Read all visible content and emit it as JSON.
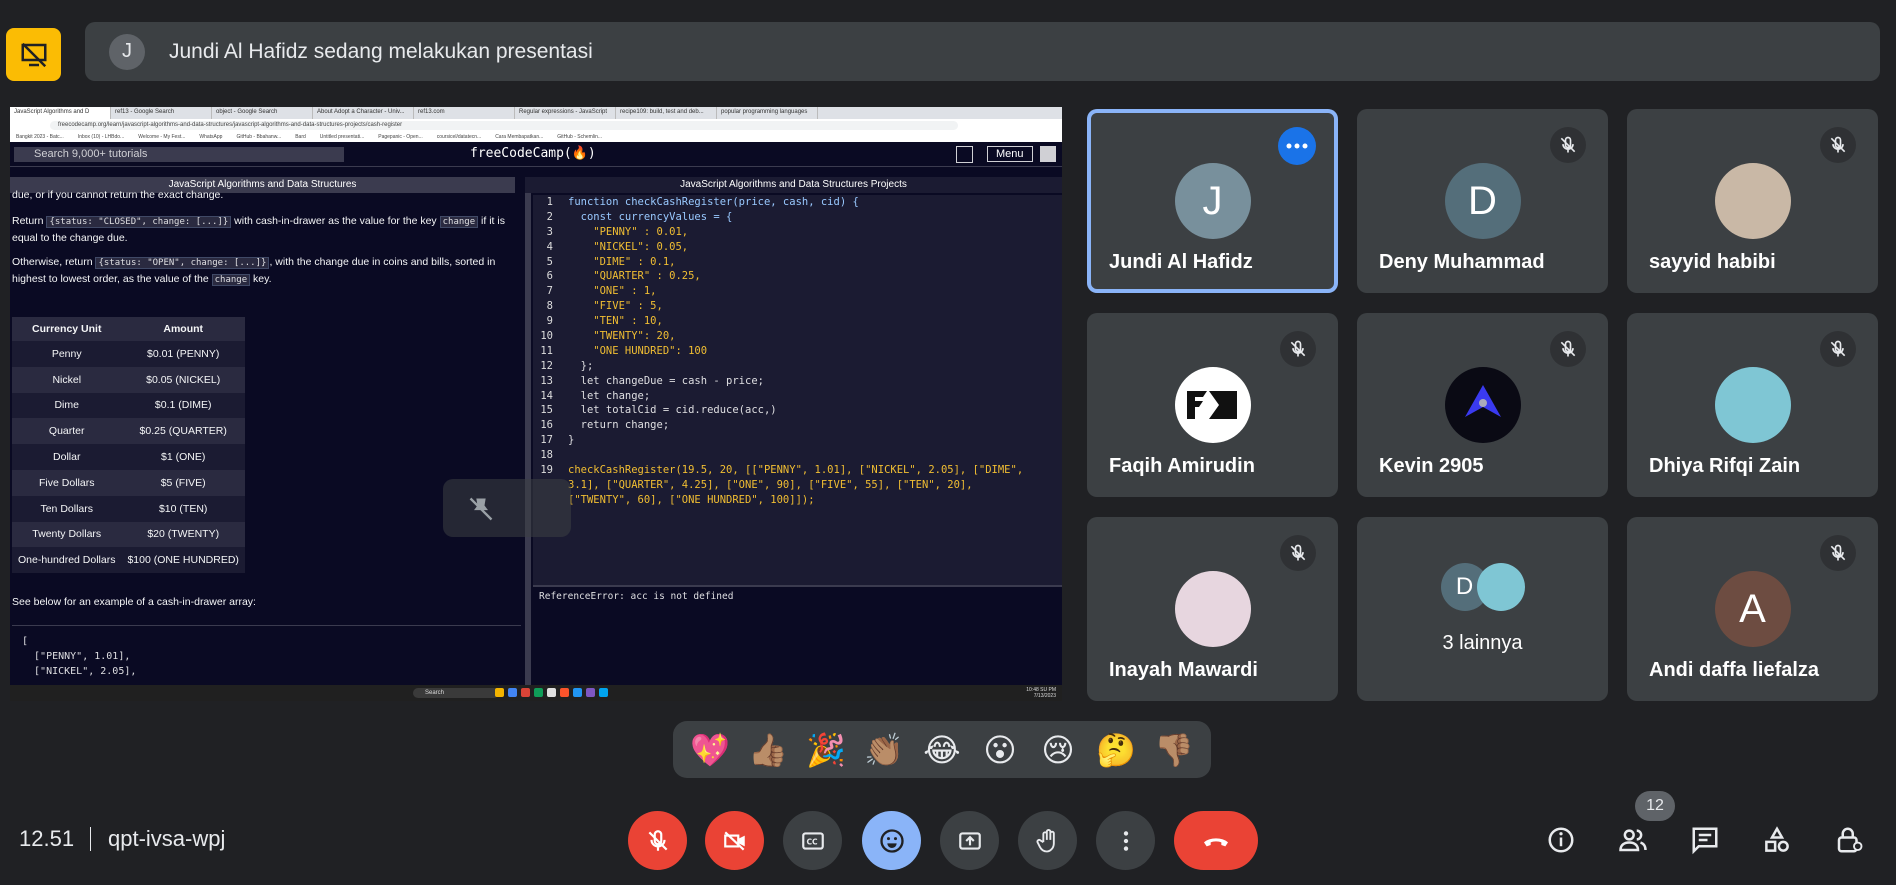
{
  "presentation": {
    "avatar_letter": "J",
    "banner_text": "Jundi Al Hafidz sedang melakukan presentasi"
  },
  "shared_screen": {
    "browser_tabs": [
      "JavaScript Algorithms and D",
      "ref13 - Google Search",
      "object - Google Search",
      "About Adopt a Character - Univ...",
      "ref13.com",
      "Regular expressions - JavaScript",
      "recipe109: build, test and deb...",
      "popular programming languages"
    ],
    "url": "freecodecamp.org/learn/javascript-algorithms-and-data-structures/javascript-algorithms-and-data-structures-projects/cash-register",
    "bookmarks": [
      "Bangkit 2023 - Batc...",
      "Inbox (10) - LHBdo...",
      "Welcome - My Fest...",
      "WhatsApp",
      "GitHub - Bbahanw...",
      "Bard",
      "Untitled presentati...",
      "Pagepanic - Open...",
      "coursicel/datatecn...",
      "Cara Membapatkan...",
      "GitHub - Schemlin..."
    ],
    "search_placeholder": "Search 9,000+ tutorials",
    "logo": "freeCodeCamp(🔥)",
    "menu_label": "Menu",
    "crumb_left": "JavaScript Algorithms and Data Structures",
    "crumb_right": "JavaScript Algorithms and Data Structures Projects",
    "desc_top": "due, or if you cannot return the exact change.",
    "desc_p1_a": "Return ",
    "desc_p1_code": "{status: \"CLOSED\", change: [...]}",
    "desc_p1_b": " with cash-in-drawer as the value for the key ",
    "desc_p1_code2": "change",
    "desc_p1_c": " if it is equal to the change due.",
    "desc_p2_a": "Otherwise, return ",
    "desc_p2_code": "{status: \"OPEN\", change: [...]}",
    "desc_p2_b": ", with the change due in coins and bills, sorted in highest to lowest order, as the value of the ",
    "desc_p2_code2": "change",
    "desc_p2_c": " key.",
    "table_headers": [
      "Currency Unit",
      "Amount"
    ],
    "table_rows": [
      [
        "Penny",
        "$0.01 (PENNY)"
      ],
      [
        "Nickel",
        "$0.05 (NICKEL)"
      ],
      [
        "Dime",
        "$0.1 (DIME)"
      ],
      [
        "Quarter",
        "$0.25 (QUARTER)"
      ],
      [
        "Dollar",
        "$1 (ONE)"
      ],
      [
        "Five Dollars",
        "$5 (FIVE)"
      ],
      [
        "Ten Dollars",
        "$10 (TEN)"
      ],
      [
        "Twenty Dollars",
        "$20 (TWENTY)"
      ],
      [
        "One-hundred Dollars",
        "$100 (ONE HUNDRED)"
      ]
    ],
    "below_text": "See below for an example of a cash-in-drawer array:",
    "array_lines": [
      "[",
      "  [\"PENNY\", 1.01],",
      "  [\"NICKEL\", 2.05],"
    ],
    "code_lines": [
      "function checkCashRegister(price, cash, cid) {",
      "  const currencyValues = {",
      "    \"PENNY\" : 0.01,",
      "    \"NICKEL\": 0.05,",
      "    \"DIME\" : 0.1,",
      "    \"QUARTER\" : 0.25,",
      "    \"ONE\" : 1,",
      "    \"FIVE\" : 5,",
      "    \"TEN\" : 10,",
      "    \"TWENTY\": 20,",
      "    \"ONE HUNDRED\": 100",
      "  };",
      "  let changeDue = cash - price;",
      "  let change;",
      "  let totalCid = cid.reduce(acc,)",
      "  return change;",
      "}",
      "",
      "checkCashRegister(19.5, 20, [[\"PENNY\", 1.01], [\"NICKEL\", 2.05], [\"DIME\",",
      "3.1], [\"QUARTER\", 4.25], [\"ONE\", 90], [\"FIVE\", 55], [\"TEN\", 20],",
      "[\"TWENTY\", 60], [\"ONE HUNDRED\", 100]]);"
    ],
    "line_numbers": [
      "1",
      "2",
      "3",
      "4",
      "5",
      "6",
      "7",
      "8",
      "9",
      "10",
      "11",
      "12",
      "13",
      "14",
      "15",
      "16",
      "17",
      "18",
      "19",
      "",
      ""
    ],
    "console_text": "ReferenceError: acc is not defined",
    "taskbar_search": "Search",
    "clock_time": "10:48 SU PM",
    "clock_date": "7/13/2023"
  },
  "participants": [
    {
      "name": "Jundi Al Hafidz",
      "letter": "J",
      "avatar_color": "#78909c",
      "active": true
    },
    {
      "name": "Deny Muhammad",
      "letter": "D",
      "avatar_color": "#546e7a"
    },
    {
      "name": "sayyid habibi",
      "letter": "",
      "avatar_color": "#c9b8a6"
    },
    {
      "name": "Faqih Amirudin",
      "letter": "",
      "avatar_color": "#ffffff"
    },
    {
      "name": "Kevin 2905",
      "letter": "",
      "avatar_color": "#0a0a14"
    },
    {
      "name": "Dhiya Rifqi Zain",
      "letter": "",
      "avatar_color": "#7fc6d4"
    },
    {
      "name": "Inayah Mawardi",
      "letter": "",
      "avatar_color": "#e7d6df"
    },
    {
      "name": "3 lainnya",
      "letter": "D",
      "avatar_color": "#546e7a"
    },
    {
      "name": "Andi daffa liefalza",
      "letter": "A",
      "avatar_color": "#6d4c41"
    }
  ],
  "reactions": [
    "💖",
    "👍🏽",
    "🎉",
    "👏🏽",
    "😂",
    "😮",
    "😢",
    "🤔",
    "👎🏽"
  ],
  "bottom_bar": {
    "time": "12.51",
    "meeting_code": "qpt-ivsa-wpj",
    "people_count": "12"
  },
  "colors": {
    "end_call": "#ea4335",
    "reaction_active": "#8ab4f8",
    "presenting_badge": "#fbbc04"
  }
}
